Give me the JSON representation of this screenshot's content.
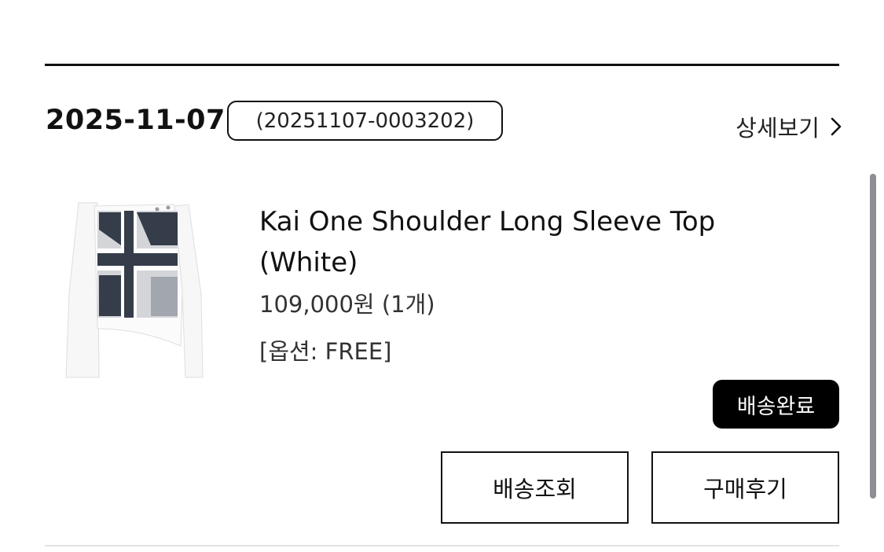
{
  "order": {
    "date": "2025-11-07",
    "number": "(20251107-0003202)",
    "detail_link_label": "상세보기",
    "detail_link_icon": "chevron-right-icon"
  },
  "product": {
    "name": "Kai One Shoulder Long Sleeve Top (White)",
    "price": "109,000원 (1개)",
    "option": "[옵션: FREE]",
    "image": "one-shoulder long sleeve top with union jack print"
  },
  "status": {
    "label": "배송완료"
  },
  "actions": {
    "track_label": "배송조회",
    "review_label": "구매후기"
  },
  "colors": {
    "text": "#111111",
    "badge_bg": "#000000",
    "badge_text": "#ffffff",
    "divider": "#e3e3e3",
    "scrollbar": "#8e8e93"
  }
}
